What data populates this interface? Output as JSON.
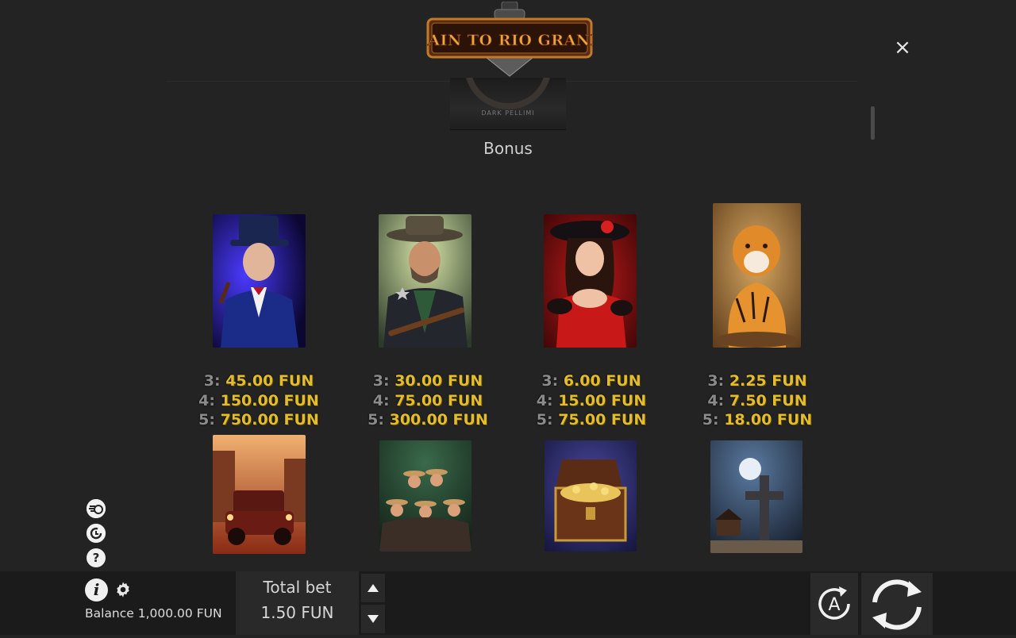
{
  "header": {
    "logo_text": "TRAIN TO RIO GRANDE",
    "bonus_thumb_brand": "DARK PELLIMI",
    "section_title": "Bonus",
    "close_label": "×"
  },
  "symbols": [
    {
      "name": "gentleman",
      "pays": [
        {
          "count": "3:",
          "amount": "45.00 FUN"
        },
        {
          "count": "4:",
          "amount": "150.00 FUN"
        },
        {
          "count": "5:",
          "amount": "750.00 FUN"
        }
      ]
    },
    {
      "name": "sheriff",
      "pays": [
        {
          "count": "3:",
          "amount": "30.00 FUN"
        },
        {
          "count": "4:",
          "amount": "75.00 FUN"
        },
        {
          "count": "5:",
          "amount": "300.00 FUN"
        }
      ]
    },
    {
      "name": "lady-in-red",
      "pays": [
        {
          "count": "3:",
          "amount": "6.00 FUN"
        },
        {
          "count": "4:",
          "amount": "15.00 FUN"
        },
        {
          "count": "5:",
          "amount": "75.00 FUN"
        }
      ]
    },
    {
      "name": "tiger",
      "pays": [
        {
          "count": "3:",
          "amount": "2.25 FUN"
        },
        {
          "count": "4:",
          "amount": "7.50 FUN"
        },
        {
          "count": "5:",
          "amount": "18.00 FUN"
        }
      ]
    },
    {
      "name": "vintage-car"
    },
    {
      "name": "cowboy-gang"
    },
    {
      "name": "treasure-chest"
    },
    {
      "name": "graveyard-cross"
    }
  ],
  "side_icons": [
    "speed-icon",
    "history-icon",
    "help-icon"
  ],
  "bottom": {
    "info_label": "i",
    "balance_text": "Balance 1,000.00 FUN",
    "total_bet_label": "Total bet",
    "total_bet_value": "1.50 FUN",
    "autoplay_label": "A"
  },
  "colors": {
    "background": "#232323",
    "bottom_bar": "#1b1b1b",
    "payout_gold": "#e3be2a",
    "payout_count_grey": "#8b8b8b"
  }
}
